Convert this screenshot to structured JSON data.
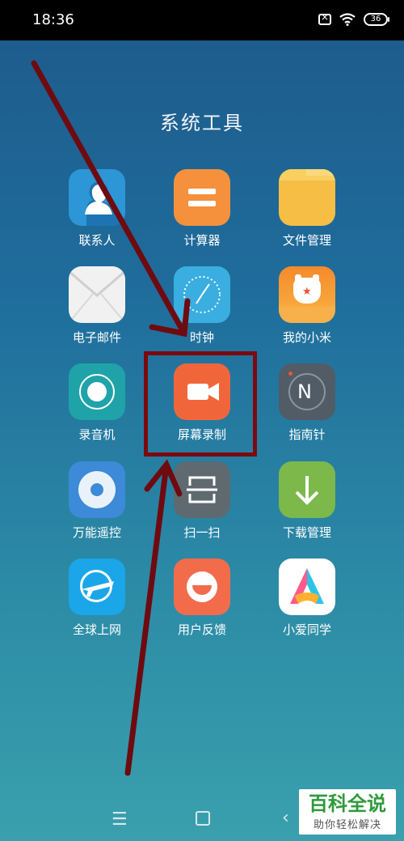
{
  "status_bar": {
    "time": "18:36",
    "battery": "36"
  },
  "folder": {
    "title": "系统工具"
  },
  "apps": [
    {
      "label": "联系人"
    },
    {
      "label": "计算器"
    },
    {
      "label": "文件管理"
    },
    {
      "label": "电子邮件"
    },
    {
      "label": "时钟"
    },
    {
      "label": "我的小米"
    },
    {
      "label": "录音机"
    },
    {
      "label": "屏幕录制"
    },
    {
      "label": "指南针"
    },
    {
      "label": "万能遥控"
    },
    {
      "label": "扫一扫"
    },
    {
      "label": "下载管理"
    },
    {
      "label": "全球上网"
    },
    {
      "label": "用户反馈"
    },
    {
      "label": "小爱同学"
    }
  ],
  "nav": {
    "menu": "☰",
    "back": "‹"
  },
  "watermark": {
    "main": "百科全说",
    "sub": "助你轻松解决"
  }
}
